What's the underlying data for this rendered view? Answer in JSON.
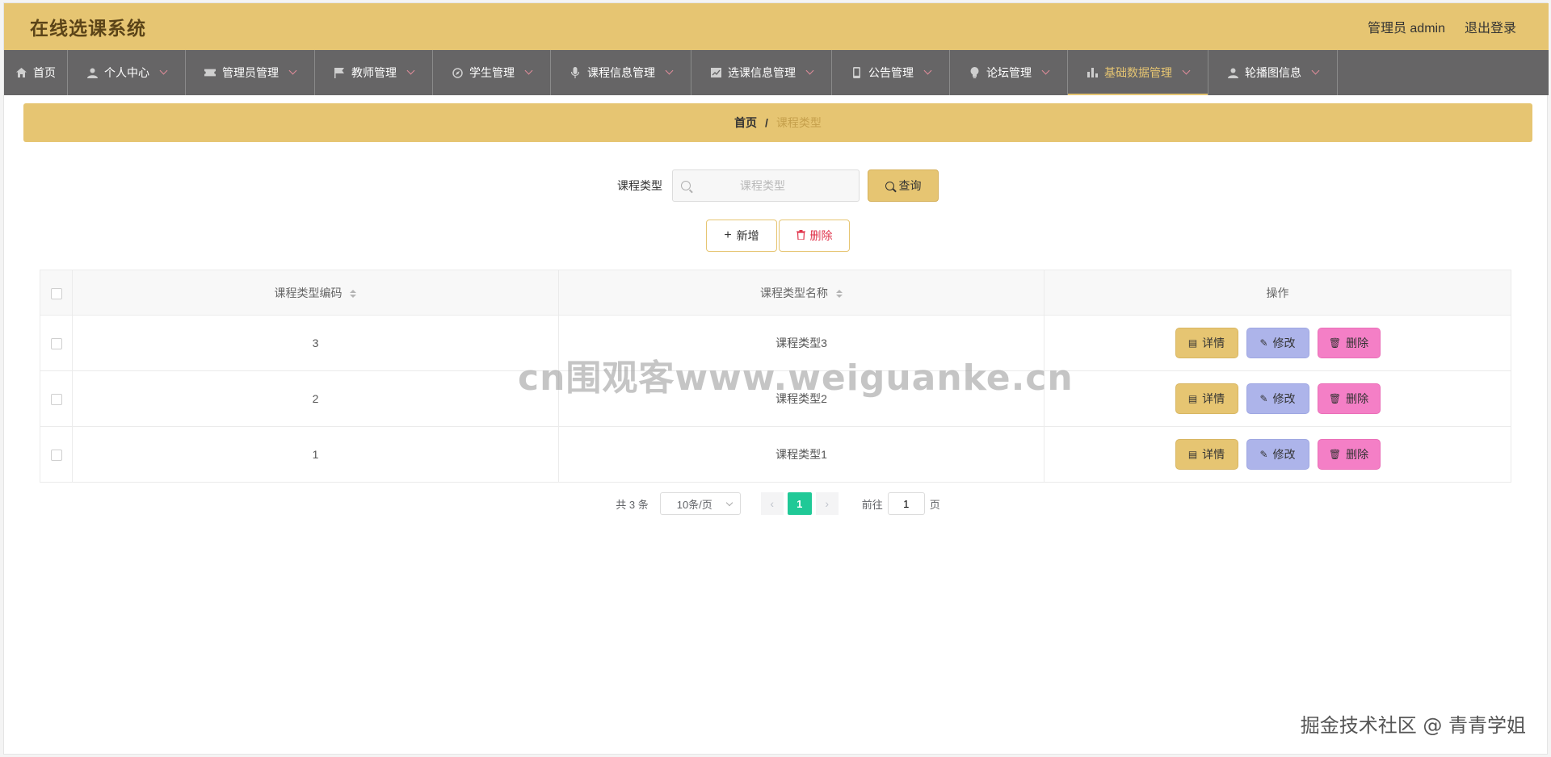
{
  "header": {
    "app_title": "在线选课系统",
    "user_label": "管理员 admin",
    "logout_label": "退出登录"
  },
  "nav": {
    "items": [
      {
        "label": "首页",
        "icon": "home-icon",
        "has_dropdown": false,
        "active": false
      },
      {
        "label": "个人中心",
        "icon": "user-icon",
        "has_dropdown": true,
        "active": false
      },
      {
        "label": "管理员管理",
        "icon": "ticket-icon",
        "has_dropdown": true,
        "active": false
      },
      {
        "label": "教师管理",
        "icon": "flag-icon",
        "has_dropdown": true,
        "active": false
      },
      {
        "label": "学生管理",
        "icon": "compass-icon",
        "has_dropdown": true,
        "active": false
      },
      {
        "label": "课程信息管理",
        "icon": "microphone-icon",
        "has_dropdown": true,
        "active": false
      },
      {
        "label": "选课信息管理",
        "icon": "chart-icon",
        "has_dropdown": true,
        "active": false
      },
      {
        "label": "公告管理",
        "icon": "phone-icon",
        "has_dropdown": true,
        "active": false
      },
      {
        "label": "论坛管理",
        "icon": "bulb-icon",
        "has_dropdown": true,
        "active": false
      },
      {
        "label": "基础数据管理",
        "icon": "bar-chart-icon",
        "has_dropdown": true,
        "active": true
      },
      {
        "label": "轮播图信息",
        "icon": "user-icon",
        "has_dropdown": true,
        "active": false
      }
    ]
  },
  "breadcrumb": {
    "home": "首页",
    "separator": "/",
    "current": "课程类型"
  },
  "search": {
    "label": "课程类型",
    "placeholder": "课程类型",
    "value": "",
    "button_label": "查询"
  },
  "actions": {
    "add_label": "新增",
    "delete_label": "删除"
  },
  "table": {
    "columns": [
      "课程类型编码",
      "课程类型名称",
      "操作"
    ],
    "rows": [
      {
        "code": "3",
        "name": "课程类型3"
      },
      {
        "code": "2",
        "name": "课程类型2"
      },
      {
        "code": "1",
        "name": "课程类型1"
      }
    ],
    "row_actions": {
      "detail": "详情",
      "edit": "修改",
      "delete": "删除"
    }
  },
  "pagination": {
    "total_text": "共 3 条",
    "page_size": "10条/页",
    "current_page": "1",
    "goto_prefix": "前往",
    "goto_value": "1",
    "goto_suffix": "页"
  },
  "watermarks": {
    "center": "cn围观客www.weiguanke.cn",
    "footer": "掘金技术社区 @ 青青学姐"
  },
  "colors": {
    "accent": "#e6c572",
    "nav_bg": "#666566",
    "page_active": "#20c997",
    "edit_btn": "#adb4ea",
    "delete_btn": "#f47fc6"
  }
}
